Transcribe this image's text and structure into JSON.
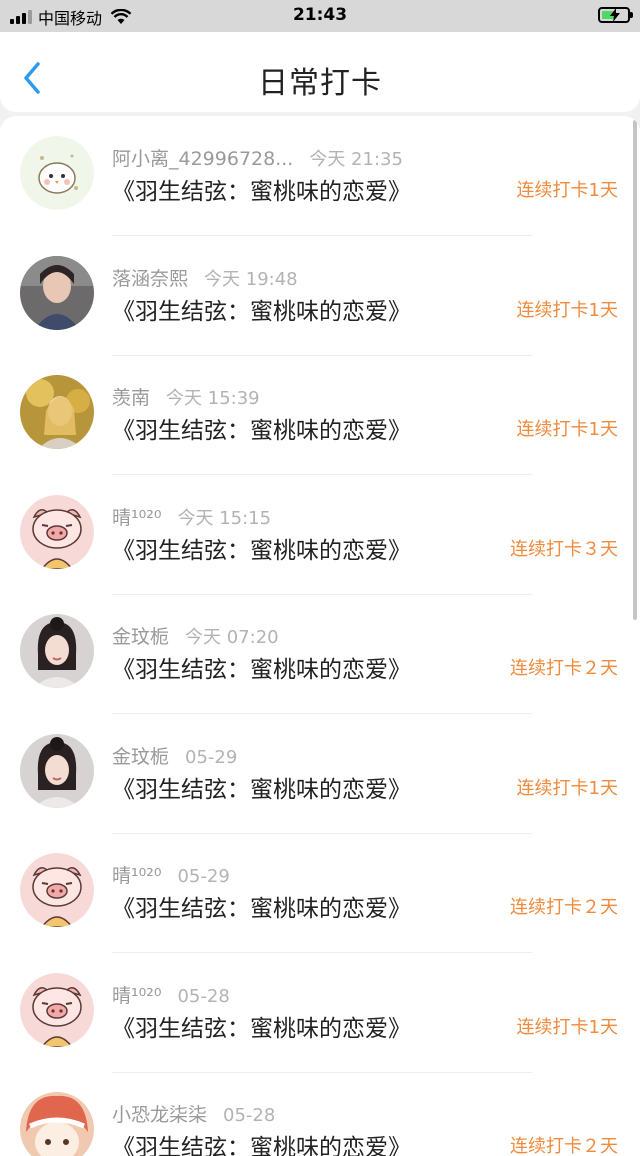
{
  "status_bar": {
    "carrier": "中国移动",
    "time": "21:43"
  },
  "header": {
    "title": "日常打卡"
  },
  "icons": {
    "back": "back-chevron-icon",
    "wifi": "wifi-icon",
    "battery": "battery-charging-icon"
  },
  "colors": {
    "accent": "#2e9bf0",
    "streak": "#f08a3c"
  },
  "checkins": [
    {
      "name": "阿小离_42996728...",
      "time": "今天 21:35",
      "book": "《羽生结弦：蜜桃味的恋爱》",
      "streak": "连续打卡1天",
      "avatar": "chick"
    },
    {
      "name": "落涵奈熙",
      "time": "今天 19:48",
      "book": "《羽生结弦：蜜桃味的恋爱》",
      "streak": "连续打卡1天",
      "avatar": "photo-dark"
    },
    {
      "name": "羡南",
      "time": "今天 15:39",
      "book": "《羽生结弦：蜜桃味的恋爱》",
      "streak": "连续打卡1天",
      "avatar": "photo-gold"
    },
    {
      "name": "晴¹⁰²⁰",
      "time": "今天 15:15",
      "book": "《羽生结弦：蜜桃味的恋爱》",
      "streak": "连续打卡３天",
      "avatar": "pig"
    },
    {
      "name": "金玟栀",
      "time": "今天 07:20",
      "book": "《羽生结弦：蜜桃味的恋爱》",
      "streak": "连续打卡２天",
      "avatar": "photo-girl"
    },
    {
      "name": "金玟栀",
      "time": "05-29",
      "book": "《羽生结弦：蜜桃味的恋爱》",
      "streak": "连续打卡1天",
      "avatar": "photo-girl"
    },
    {
      "name": "晴¹⁰²⁰",
      "time": "05-29",
      "book": "《羽生结弦：蜜桃味的恋爱》",
      "streak": "连续打卡２天",
      "avatar": "pig"
    },
    {
      "name": "晴¹⁰²⁰",
      "time": "05-28",
      "book": "《羽生结弦：蜜桃味的恋爱》",
      "streak": "连续打卡1天",
      "avatar": "pig"
    },
    {
      "name": "小恐龙柒柒",
      "time": "05-28",
      "book": "《羽生结弦：蜜桃味的恋爱》",
      "streak": "连续打卡２天",
      "avatar": "anime"
    }
  ]
}
